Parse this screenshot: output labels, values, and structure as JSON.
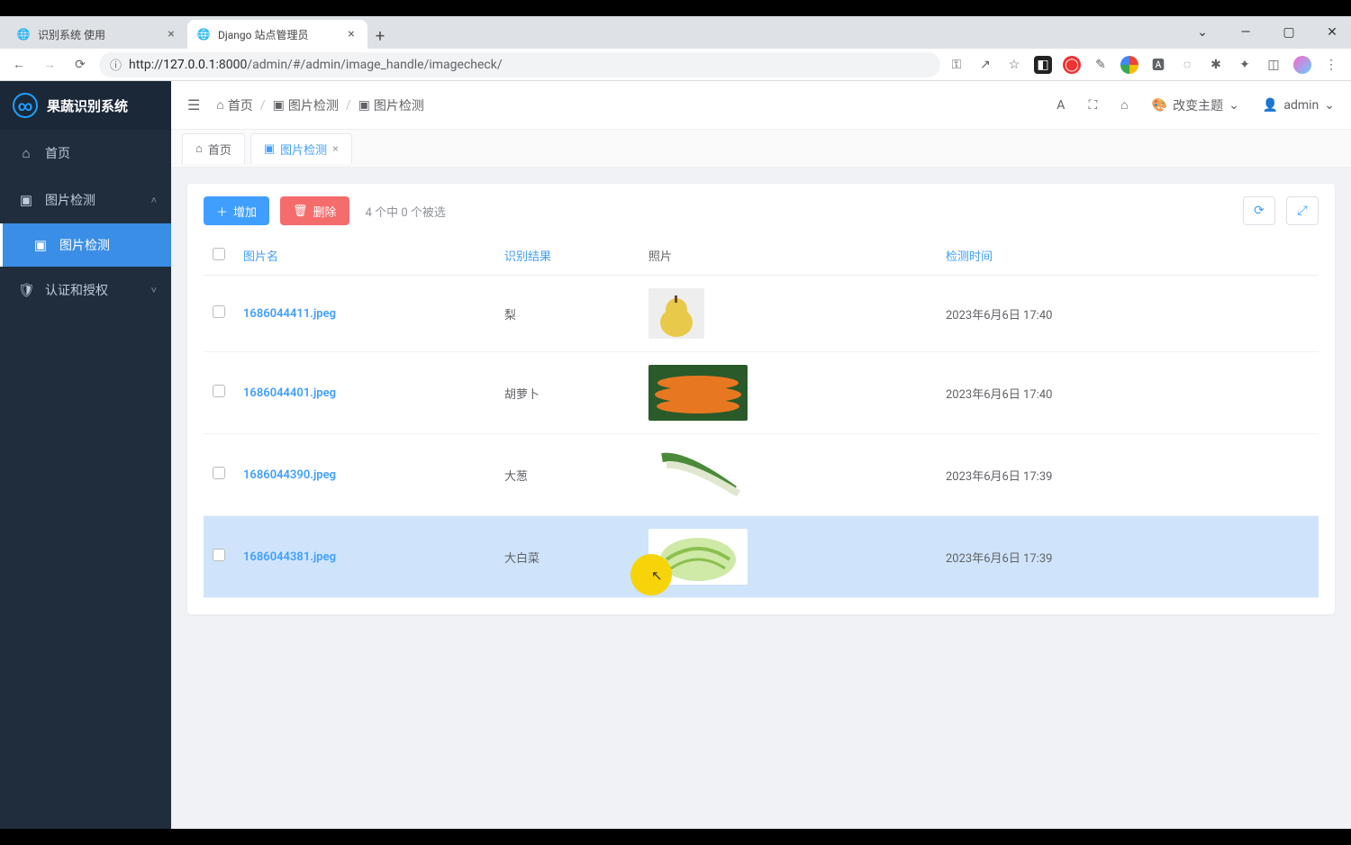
{
  "browser": {
    "tabs": [
      {
        "title": "识别系统 使用",
        "active": false
      },
      {
        "title": "Django 站点管理员",
        "active": true
      }
    ],
    "url_display": {
      "host": "127.0.0.1",
      "port": ":8000",
      "path": "/admin/#/admin/image_handle/imagecheck/"
    }
  },
  "app": {
    "brand": "果蔬识别系统",
    "sidebar": {
      "home": "首页",
      "image_group": "图片检测",
      "image_item": "图片检测",
      "auth_group": "认证和授权"
    },
    "header": {
      "breadcrumbs": {
        "home": "首页",
        "mid": "图片检测",
        "last": "图片检测"
      },
      "theme": "改变主题",
      "user": "admin"
    },
    "pagetabs": {
      "home": "首页",
      "current": "图片检测"
    },
    "toolbar": {
      "add": "增加",
      "delete": "删除",
      "selection": "4 个中 0 个被选"
    },
    "columns": {
      "name": "图片名",
      "result": "识别结果",
      "photo": "照片",
      "time": "检测时间"
    },
    "rows": [
      {
        "name": "1686044411.jpeg",
        "result": "梨",
        "time": "2023年6月6日 17:40",
        "thumb": "pear"
      },
      {
        "name": "1686044401.jpeg",
        "result": "胡萝卜",
        "time": "2023年6月6日 17:40",
        "thumb": "carrot"
      },
      {
        "name": "1686044390.jpeg",
        "result": "大葱",
        "time": "2023年6月6日 17:39",
        "thumb": "scallion"
      },
      {
        "name": "1686044381.jpeg",
        "result": "大白菜",
        "time": "2023年6月6日 17:39",
        "thumb": "cabbage"
      }
    ]
  }
}
